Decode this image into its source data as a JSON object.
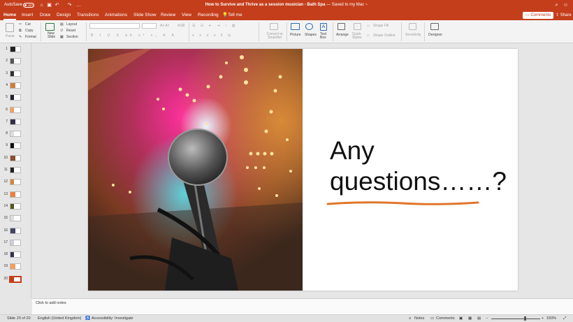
{
  "titlebar": {
    "autosave_label": "AutoSave",
    "autosave_state": "OFF",
    "document_title": "How to Survive and Thrive as a session musician - Bath Spa",
    "save_status": "— Saved to my Mac ~"
  },
  "tabs": [
    "Home",
    "Insert",
    "Draw",
    "Design",
    "Transitions",
    "Animations",
    "Slide Show",
    "Review",
    "View",
    "Recording",
    "Tell me"
  ],
  "header_buttons": {
    "comments": "Comments",
    "share": "Share"
  },
  "ribbon": {
    "paste": "Paste",
    "cut": "Cut",
    "copy": "Copy",
    "format": "Format",
    "new_slide": "New Slide",
    "layout": "Layout",
    "reset": "Reset",
    "section": "Section",
    "convert_smartart": "Convert to SmartArt",
    "picture": "Picture",
    "shapes": "Shapes",
    "text_box": "Text Box",
    "arrange": "Arrange",
    "quick_styles": "Quick Styles",
    "shape_fill": "Shape Fill",
    "shape_outline": "Shape Outline",
    "sensitivity": "Sensitivity",
    "designer": "Designer"
  },
  "thumbnails": [
    "1",
    "2",
    "3",
    "4",
    "5",
    "6",
    "7",
    "8",
    "9",
    "10",
    "11",
    "12",
    "13",
    "14",
    "15",
    "16",
    "17",
    "18",
    "19",
    "20"
  ],
  "slide": {
    "line1": "Any",
    "line2": "questions……?",
    "underline_color": "#e0762a"
  },
  "notes_placeholder": "Click to add notes",
  "status": {
    "slide_counter": "Slide 20 of 20",
    "language": "English (United Kingdom)",
    "accessibility": "Accessibility: Investigate",
    "notes": "Notes",
    "comments": "Comments",
    "zoom": "150%"
  },
  "colors": {
    "accent": "#c43e1c"
  }
}
